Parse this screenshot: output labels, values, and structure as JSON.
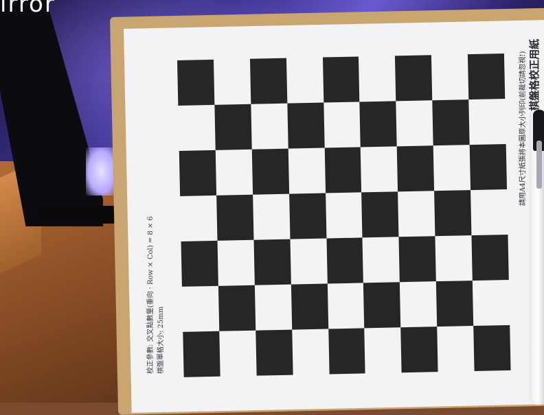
{
  "scene": {
    "overlay_text": "irror",
    "checkerboard": {
      "rows": 7,
      "cols": 9,
      "dark_color": "#262629",
      "light_color": "#f3f2f4"
    },
    "paper_caption": {
      "title": "JDLAB Open CV 棋盤格校正用紙",
      "note": "請用A4尺寸紙張將本圖原大小列印(前裁切請忽視!)"
    },
    "paper_params": {
      "line1": "校正參數: 交叉點數量(垂向 · Row × Col) = 8 × 6",
      "line2": "棋盤單格大小: 25mm"
    }
  }
}
